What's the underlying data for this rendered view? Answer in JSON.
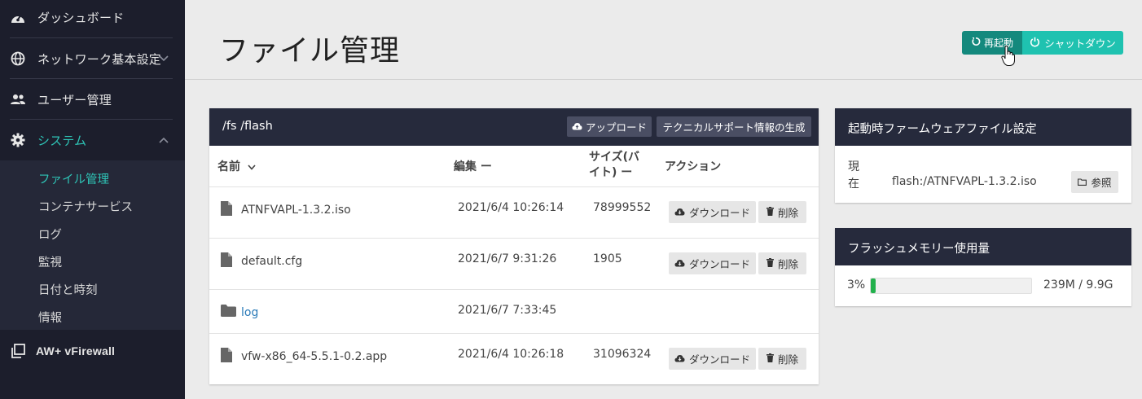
{
  "sidebar": {
    "items": [
      {
        "label": "ダッシュボード",
        "icon": "speedometer-icon"
      },
      {
        "label": "ネットワーク基本設定",
        "icon": "globe-icon"
      },
      {
        "label": "ユーザー管理",
        "icon": "users-icon"
      },
      {
        "label": "システム",
        "icon": "gear-icon"
      }
    ],
    "sub_items": [
      "ファイル管理",
      "コンテナサービス",
      "ログ",
      "監視",
      "日付と時刻",
      "情報"
    ],
    "bottom": {
      "label": "AW+ vFirewall",
      "icon": "copy-icon"
    }
  },
  "header": {
    "title": "ファイル管理",
    "restart_label": "再起動",
    "shutdown_label": "シャットダウン"
  },
  "files": {
    "path": "/fs /flash",
    "upload_label": "アップロード",
    "support_label": "テクニカルサポート情報の生成",
    "columns": {
      "name": "名前",
      "edit": "編集 ー",
      "size1": "サイズ(バ",
      "size2": "イト) ー",
      "action": "アクション"
    },
    "download_label": "ダウンロード",
    "delete_label": "削除",
    "rows": [
      {
        "name": "ATNFVAPL-1.3.2.iso",
        "date": "2021/6/4 10:26:14",
        "size": "78999552"
      },
      {
        "name": "default.cfg",
        "date": "2021/6/7 9:31:26",
        "size": "1905"
      },
      {
        "name": "log",
        "date": "2021/6/7 7:33:45",
        "size": ""
      },
      {
        "name": "vfw-x86_64-5.5.1-0.2.app",
        "date": "2021/6/4 10:26:18",
        "size": "31096324"
      }
    ]
  },
  "firmware": {
    "title": "起動時ファームウェアファイル設定",
    "label1": "現",
    "label2": "在",
    "value": "flash:/ATNFVAPL-1.3.2.iso",
    "browse_label": "参照"
  },
  "memory": {
    "title": "フラッシュメモリー使用量",
    "percent_label": "3%",
    "percent": 3,
    "usage": "239M / 9.9G"
  },
  "colors": {
    "accent": "#2ec4b6",
    "sidebar": "#1c1e2c",
    "panel_head": "#262a3c",
    "restart": "#14897d",
    "shutdown": "#1fc2b0",
    "progress": "#22b14c"
  }
}
